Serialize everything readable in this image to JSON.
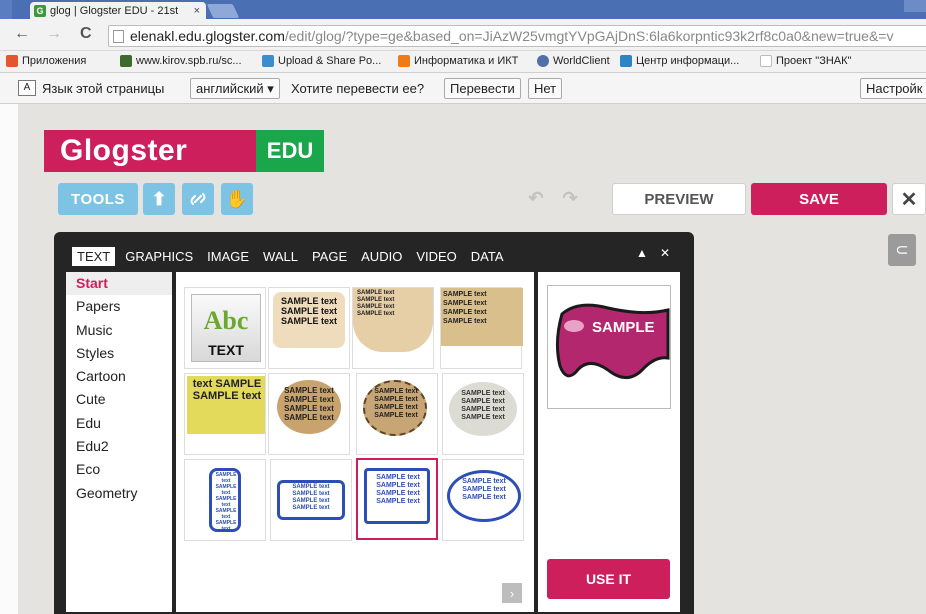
{
  "browser": {
    "tab_title": "glog | Glogster EDU - 21st",
    "tab_favicon": "G",
    "tab_close": "×",
    "url_host": "elenakl.edu.glogster.com",
    "url_path": "/edit/glog/?type=ge&based_on=JiAzW25vmgtYVpGAjDnS:6la6korpntic93k2rf8c0a0&new=true&=v",
    "bookmarks": [
      {
        "label": "Приложения",
        "icon_color": "#e2572c"
      },
      {
        "label": "www.kirov.spb.ru/sc...",
        "icon_color": "#3d6b2e"
      },
      {
        "label": "Upload & Share Po...",
        "icon_color": "#3c8dcf"
      },
      {
        "label": "Информатика и ИКТ",
        "icon_color": "#f07b16"
      },
      {
        "label": "WorldClient",
        "icon_color": "#4f6fa6"
      },
      {
        "label": "Центр информаци...",
        "icon_color": "#2a85c7"
      },
      {
        "label": "Проект \"ЗНАК\"",
        "icon_color": "#bbbbbb"
      }
    ]
  },
  "translate": {
    "prompt": "Язык этой страницы",
    "language": "английский",
    "question": "Хотите перевести ее?",
    "translate_btn": "Перевести",
    "no_btn": "Нет",
    "settings_btn": "Настройк"
  },
  "app": {
    "logo_text": "Glogster",
    "logo_edu": "EDU",
    "tools_label": "TOOLS",
    "preview_label": "PREVIEW",
    "save_label": "SAVE",
    "close_glyph": "✕",
    "colors": {
      "brand": "#cc1f5b",
      "edu_green": "#1aa64a",
      "tool_blue": "#7dc3e4"
    }
  },
  "panel": {
    "tabs": [
      "TEXT",
      "GRAPHICS",
      "IMAGE",
      "WALL",
      "PAGE",
      "AUDIO",
      "VIDEO",
      "DATA"
    ],
    "active_tab": "TEXT",
    "collapse_glyph": "▲",
    "close_glyph": "✕",
    "categories": [
      "Start",
      "Papers",
      "Music",
      "Styles",
      "Cartoon",
      "Cute",
      "Edu",
      "Edu2",
      "Eco",
      "Geometry"
    ],
    "active_category": "Start",
    "thumb_abc": "Abc",
    "thumb_text": "TEXT",
    "sample": "SAMPLE text",
    "sample_wide": "text SAMPLE",
    "preview_text": "SAMPLE",
    "use_it": "USE IT",
    "next_glyph": "›"
  }
}
